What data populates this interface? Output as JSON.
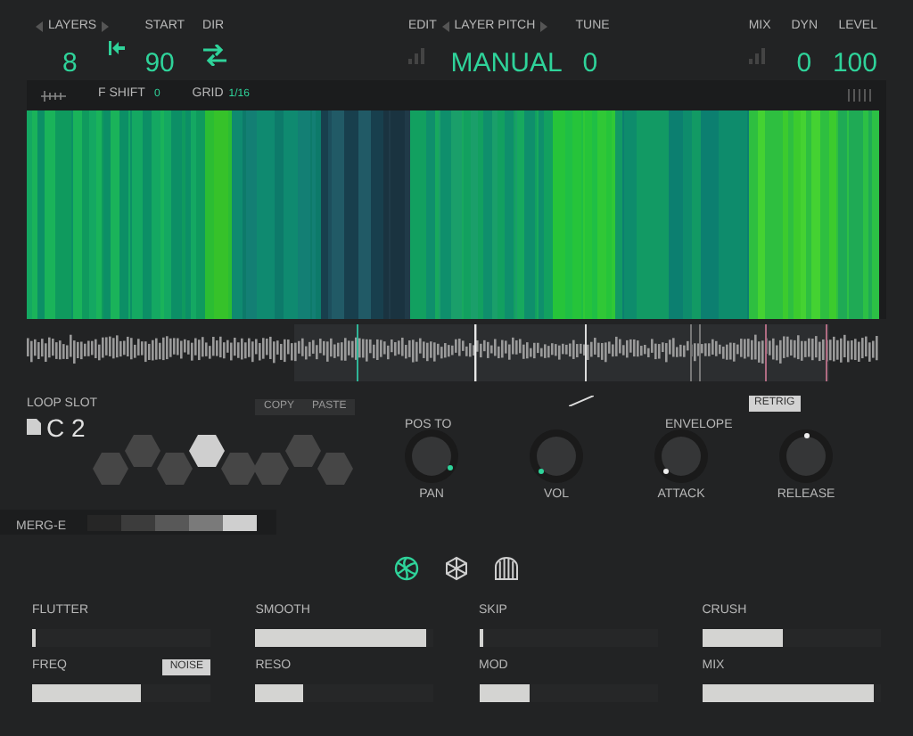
{
  "top": {
    "layers": {
      "label": "LAYERS",
      "value": "8"
    },
    "start": {
      "label": "START",
      "value": "90"
    },
    "dir": {
      "label": "DIR"
    },
    "edit": {
      "label": "EDIT"
    },
    "layer_pitch": {
      "label": "LAYER PITCH",
      "value": "MANUAL"
    },
    "tune": {
      "label": "TUNE",
      "value": "0"
    },
    "mix": {
      "label": "MIX"
    },
    "dyn": {
      "label": "DYN",
      "value": "0"
    },
    "level": {
      "label": "LEVEL",
      "value": "100"
    }
  },
  "spectrogram_bar": {
    "f_shift": {
      "label": "F SHIFT",
      "value": "0"
    },
    "grid": {
      "label": "GRID",
      "value": "1/16"
    }
  },
  "loop_slot": {
    "label": "LOOP SLOT",
    "value": "C 2",
    "copy": "COPY",
    "paste": "PASTE"
  },
  "hexes": [
    {
      "kind": "low",
      "selected": false
    },
    {
      "kind": "high",
      "selected": false
    },
    {
      "kind": "low",
      "selected": false
    },
    {
      "kind": "high",
      "selected": true
    },
    {
      "kind": "low",
      "selected": false
    },
    {
      "kind": "low",
      "selected": false
    },
    {
      "kind": "high",
      "selected": false
    },
    {
      "kind": "low",
      "selected": false
    }
  ],
  "pos_to": {
    "label": "POS TO"
  },
  "envelope": {
    "label": "ENVELOPE",
    "retrig": "RETRIG",
    "retrig_on": true
  },
  "knobs": [
    {
      "label": "PAN",
      "accent": true
    },
    {
      "label": "VOL",
      "accent": true
    },
    {
      "label": "ATTACK",
      "accent": false
    },
    {
      "label": "RELEASE",
      "accent": false
    }
  ],
  "merge": {
    "label": "MERG-E",
    "steps": [
      {
        "color": "#262626"
      },
      {
        "color": "#3c3c3c"
      },
      {
        "color": "#585858"
      },
      {
        "color": "#7a7a7a"
      },
      {
        "color": "#cfcfcf"
      }
    ]
  },
  "modes": [
    {
      "selected": true
    },
    {
      "selected": false
    },
    {
      "selected": false
    }
  ],
  "sliders": [
    {
      "label": "FLUTTER",
      "level": 0.02
    },
    {
      "label": "SMOOTH",
      "level": 1.0
    },
    {
      "label": "SKIP",
      "level": 0.02
    },
    {
      "label": "CRUSH",
      "level": 0.47
    },
    {
      "label": "FREQ",
      "level": 0.64,
      "button": "NOISE"
    },
    {
      "label": "RESO",
      "level": 0.28
    },
    {
      "label": "MOD",
      "level": 0.3
    },
    {
      "label": "MIX",
      "level": 1.0
    }
  ]
}
